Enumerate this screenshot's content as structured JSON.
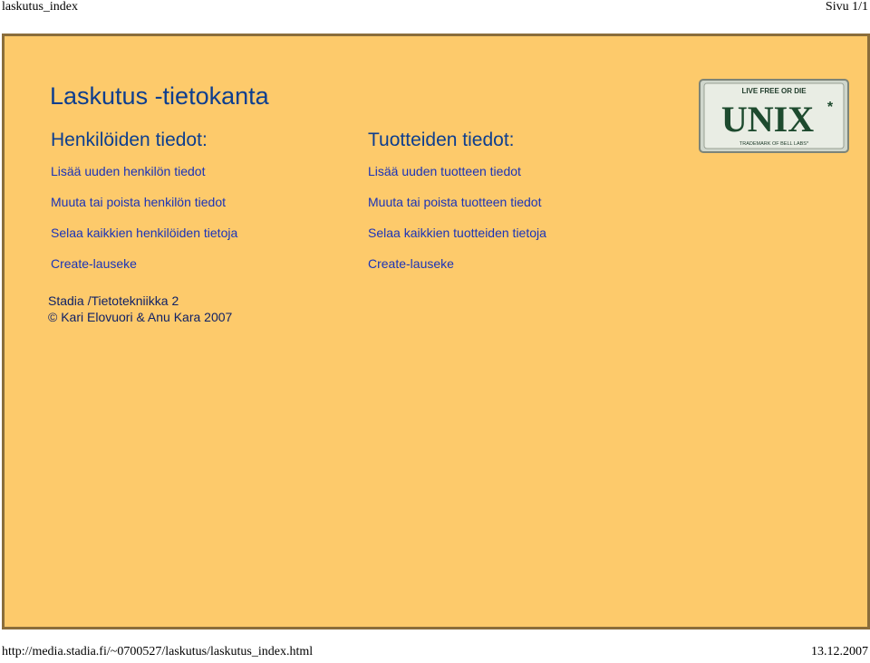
{
  "print_header": {
    "left": "laskutus_index",
    "right": "Sivu 1/1"
  },
  "page": {
    "title": "Laskutus -tietokanta"
  },
  "persons": {
    "heading": "Henkilöiden tiedot:",
    "links": [
      "Lisää uuden henkilön tiedot",
      "Muuta tai poista henkilön tiedot",
      "Selaa kaikkien henkilöiden tietoja",
      "Create-lauseke"
    ]
  },
  "products": {
    "heading": "Tuotteiden tiedot:",
    "links": [
      "Lisää uuden tuotteen tiedot",
      "Muuta tai poista tuotteen tiedot",
      "Selaa kaikkien tuotteiden tietoja",
      "Create-lauseke"
    ]
  },
  "credits": {
    "line1": "Stadia /Tietotekniikka 2",
    "line2": "© Kari Elovuori & Anu Kara 2007"
  },
  "logo": {
    "top_text": "LIVE FREE OR DIE",
    "main_text": "UNIX",
    "star": "*",
    "bottom_text": "TRADEMARK OF BELL LABS*"
  },
  "print_footer": {
    "left": "http://media.stadia.fi/~0700527/laskutus/laskutus_index.html",
    "right": "13.12.2007"
  },
  "colors": {
    "page_background": "#fdca6b",
    "heading": "#0d3e8f",
    "link": "#1a33b8",
    "frame_border": "#8a6d3b"
  }
}
